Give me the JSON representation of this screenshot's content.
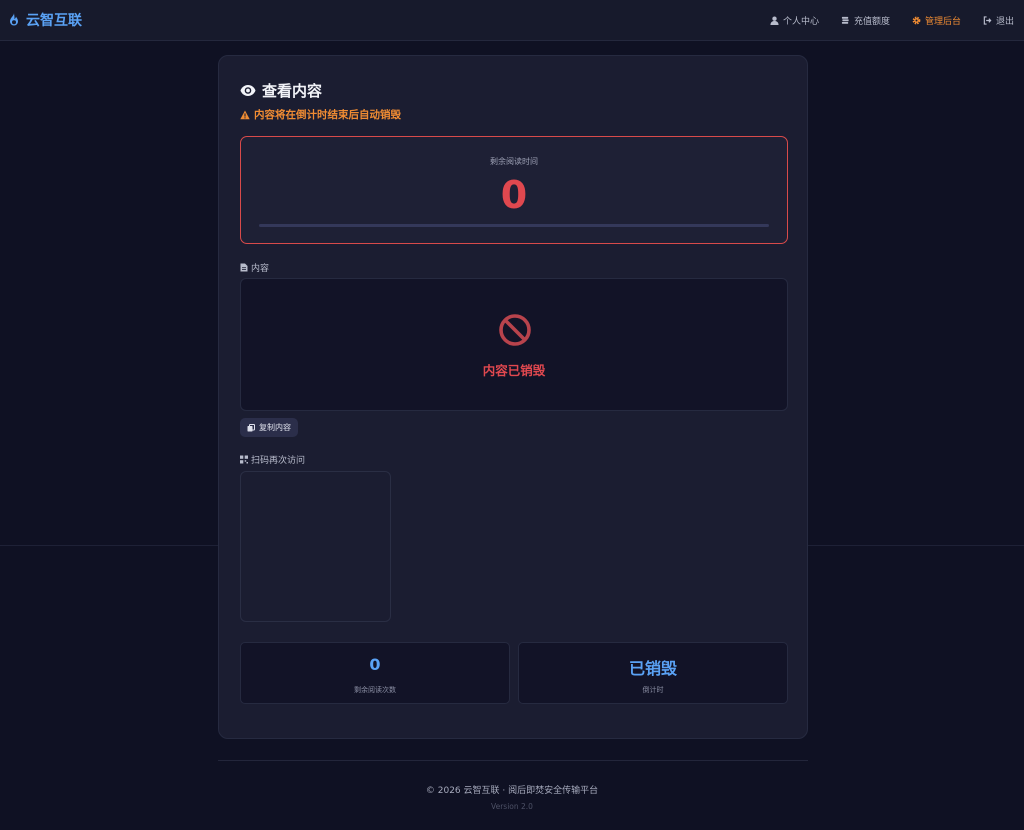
{
  "header": {
    "brand": "云智互联",
    "nav": [
      {
        "label": "个人中心",
        "icon": "user-icon"
      },
      {
        "label": "充值额度",
        "icon": "coins-icon"
      },
      {
        "label": "管理后台",
        "icon": "gear-icon"
      },
      {
        "label": "退出",
        "icon": "logout-icon"
      }
    ]
  },
  "card": {
    "title": "查看内容",
    "warning": "内容将在倒计时结束后自动销毁",
    "timer": {
      "label": "剩余阅读时间",
      "value": "0"
    },
    "content_label": "内容",
    "destroyed_text": "内容已销毁",
    "copy_label": "复制内容",
    "qr_label": "扫码再次访问",
    "stats": [
      {
        "value": "0",
        "label": "剩余阅读次数"
      },
      {
        "value": "已销毁",
        "label": "倒计时"
      }
    ]
  },
  "footer": {
    "copyright": "© 2026 云智互联 · 阅后即焚安全传输平台",
    "version": "Version 2.0"
  },
  "colors": {
    "accent": "#5aa2f5",
    "warning": "#f08c33",
    "danger": "#e0484f",
    "background": "#0f1123"
  }
}
